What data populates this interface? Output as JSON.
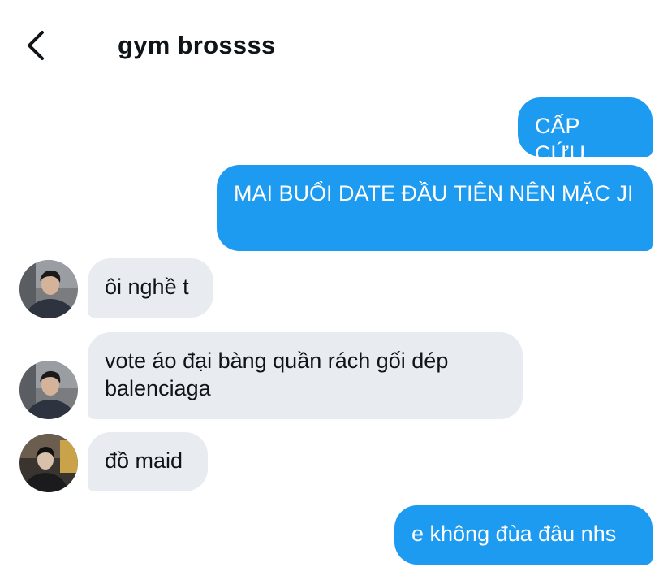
{
  "header": {
    "back_icon": "chevron-left-icon",
    "title": "gym brossss"
  },
  "colors": {
    "sent_bubble": "#1d9bf0",
    "received_bubble": "#e8ebef",
    "text": "#0f1419"
  },
  "messages": [
    {
      "direction": "sent",
      "text": "CẤP CỨU"
    },
    {
      "direction": "sent",
      "text": "MAI BUỔI DATE ĐẦU TIÊN NÊN MẶC JI"
    },
    {
      "direction": "received",
      "text": "ôi nghề t"
    },
    {
      "direction": "received",
      "text": "vote áo đại bàng quần rách gối dép balenciaga"
    },
    {
      "direction": "received",
      "text": "đồ maid"
    },
    {
      "direction": "sent",
      "text": "e không đùa đâu nhs"
    }
  ]
}
